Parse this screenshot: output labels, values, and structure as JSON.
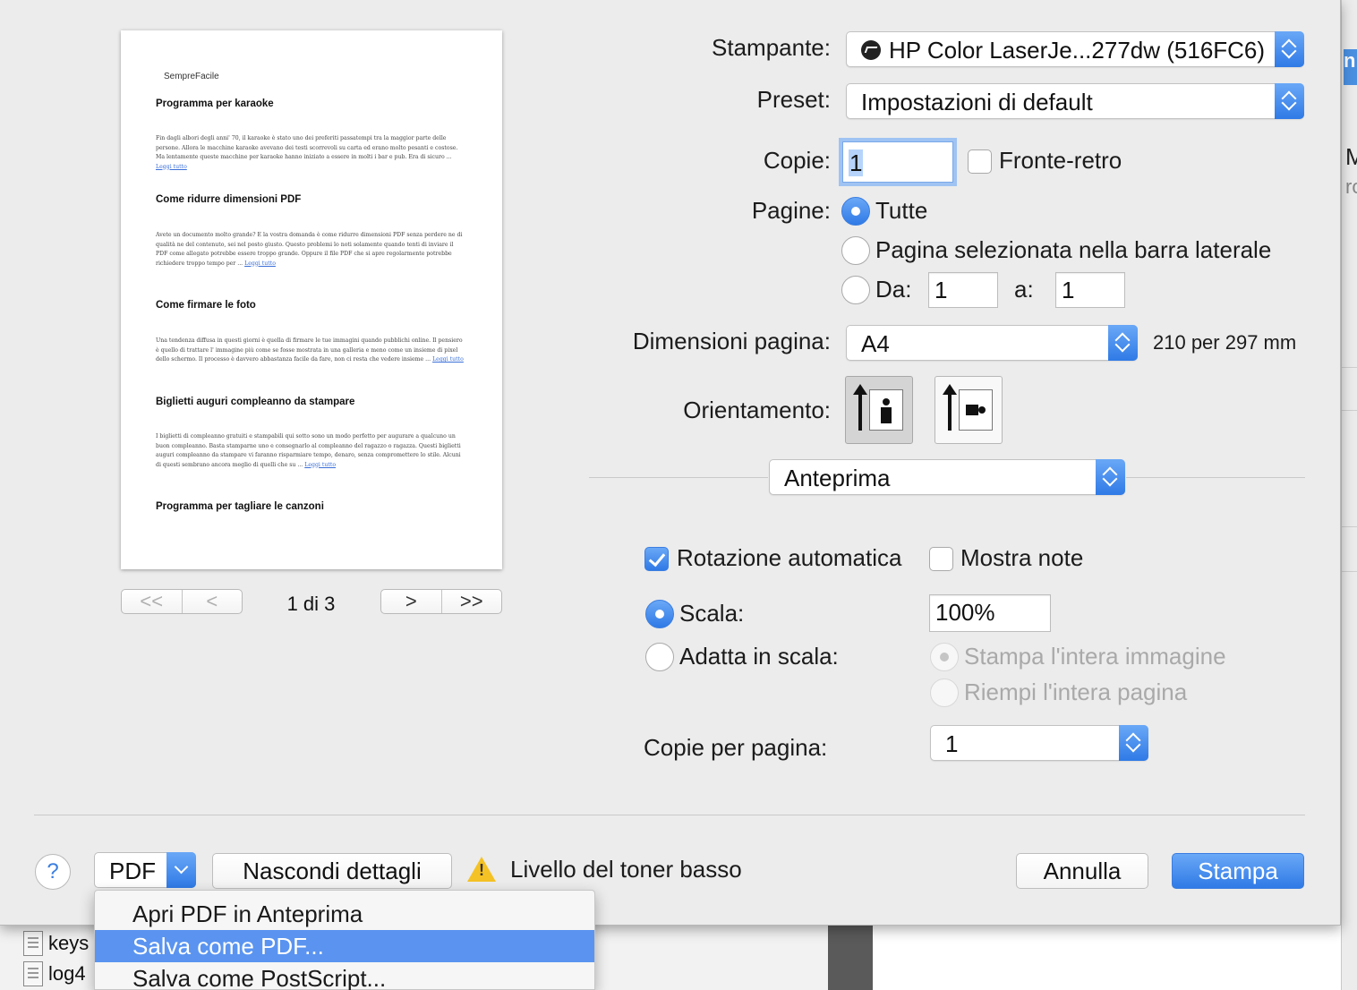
{
  "preview": {
    "brand": "SempreFacile",
    "sections": [
      {
        "title": "Programma per karaoke",
        "body": "Fin dagli albori degli anni' 70, il karaoke è stato uno dei preferiti passatempi tra la maggior parte delle persone. Allora le macchine karaoke avevano dei testi scorrevoli su carta ed erano molto pesanti e costose. Ma lentamente queste macchine per karaoke hanno iniziato a essere in molti i bar e pub. Era di sicuro ...",
        "link": "Leggi tutto"
      },
      {
        "title": "Come ridurre dimensioni PDF",
        "body": "Avete un documento molto grande? E la vostra domanda è come ridurre dimensioni PDF senza perdere ne di qualità ne del contenuto, sei nel posto giusto. Questo problemi lo noti solamente quando tenti di inviare il PDF come allegato potrebbe essere troppo grande. Oppure il file PDF che si apre regolarmente potrebbe richiedere troppo tempo per ...",
        "link": "Leggi tutto"
      },
      {
        "title": "Come firmare le foto",
        "body": "Una tendenza diffusa in questi giorni è quella di firmare le tue immagini quando pubblichi online. Il pensiero è quello di trattare l' immagine più come se fosse mostrata in una galleria e meno come un insieme di pixel dello schermo. Il processo è davvero abbastanza facile da fare, non ci resta che vedere insieme ...",
        "link": "Leggi tutto"
      },
      {
        "title": "Biglietti auguri compleanno da stampare",
        "body": "I biglietti di compleanno gratuiti e stampabili qui sotto sono un modo perfetto per augurare a qualcuno un buon compleanno. Basta stamparne uno e consegnarlo al compleanno del ragazzo o ragazza. Questi biglietti auguri compleanno da stampare vi faranno risparmiare tempo, denaro, senza compromettere lo stile. Alcuni di questi sembrano ancora meglio di quelli che su ...",
        "link": "Leggi tutto"
      },
      {
        "title": "Programma per tagliare le canzoni",
        "body": "",
        "link": ""
      }
    ]
  },
  "pager": {
    "first": "<<",
    "prev": "<",
    "next": ">",
    "last": ">>",
    "page_label": "1 di 3"
  },
  "form": {
    "printer_label": "Stampante:",
    "printer_value": "HP Color LaserJe...277dw (516FC6)",
    "preset_label": "Preset:",
    "preset_value": "Impostazioni di default",
    "copies_label": "Copie:",
    "copies_value": "1",
    "duplex_label": "Fronte-retro",
    "pages_label": "Pagine:",
    "pages_all": "Tutte",
    "pages_selected": "Pagina selezionata nella barra laterale",
    "pages_from_label": "Da:",
    "pages_from_value": "1",
    "pages_to_label": "a:",
    "pages_to_value": "1",
    "paper_size_label": "Dimensioni pagina:",
    "paper_size_value": "A4",
    "paper_size_dims": "210 per 297 mm",
    "orientation_label": "Orientamento:",
    "section_popup_value": "Anteprima",
    "auto_rotate_label": "Rotazione automatica",
    "show_notes_label": "Mostra note",
    "scale_label": "Scala:",
    "scale_value": "100%",
    "fit_label": "Adatta in scala:",
    "fit_whole": "Stampa l'intera immagine",
    "fit_fill": "Riempi l'intera pagina",
    "copies_per_page_label": "Copie per pagina:",
    "copies_per_page_value": "1"
  },
  "footer": {
    "help": "?",
    "pdf": "PDF",
    "hide_details": "Nascondi dettagli",
    "toner_warning": "Livello del toner basso",
    "cancel": "Annulla",
    "print": "Stampa"
  },
  "pdf_menu": [
    "Apri PDF in Anteprima",
    "Salva come PDF...",
    "Salva come PostScript..."
  ],
  "background": {
    "file1": "keys",
    "file2": "log4",
    "right_tab": "np",
    "right_letter": "M",
    "right_sub": "ro"
  },
  "colors": {
    "accent": "#3b7ee0",
    "menu_highlight": "#5a94f0",
    "warning": "#f5c225"
  }
}
